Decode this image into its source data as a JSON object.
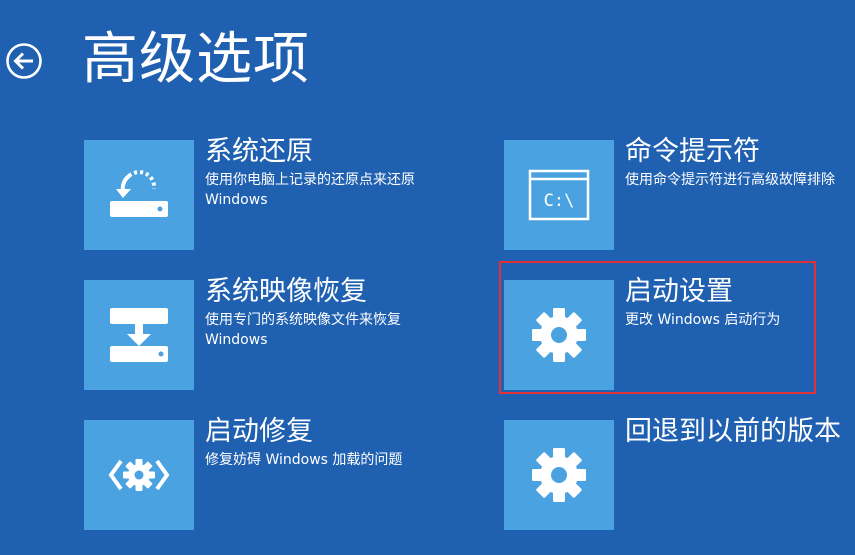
{
  "page": {
    "title": "高级选项",
    "back_icon": "back-arrow-icon"
  },
  "options": [
    {
      "name": "系统还原",
      "description": "使用你电脑上记录的还原点来还原 Windows",
      "icon": "system-restore-icon"
    },
    {
      "name": "命令提示符",
      "description": "使用命令提示符进行高级故障排除",
      "icon": "command-prompt-icon",
      "icon_text": "C:\\"
    },
    {
      "name": "系统映像恢复",
      "description": "使用专门的系统映像文件来恢复 Windows",
      "icon": "system-image-recovery-icon"
    },
    {
      "name": "启动设置",
      "description": "更改 Windows 启动行为",
      "icon": "gear-icon",
      "highlighted": true,
      "highlight_color": "#e0303a"
    },
    {
      "name": "启动修复",
      "description": "修复妨碍 Windows 加载的问题",
      "icon": "startup-repair-icon"
    },
    {
      "name": "回退到以前的版本",
      "description": "",
      "icon": "gear-icon"
    }
  ],
  "colors": {
    "background": "#1f60b1",
    "tile": "#4aa3e0",
    "text": "#ffffff",
    "highlight": "#e0303a"
  }
}
